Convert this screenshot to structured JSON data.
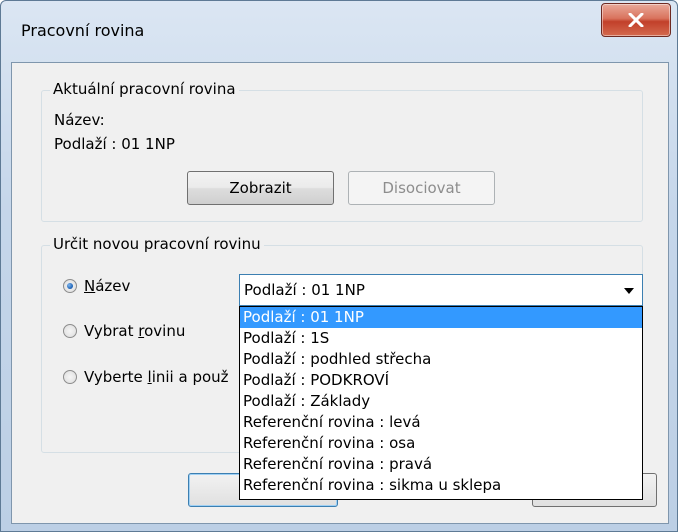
{
  "window": {
    "title": "Pracovní rovina"
  },
  "current_plane": {
    "group_label": "Aktuální pracovní rovina",
    "name_line": "Název:",
    "level_line": "Podlaží : 01 1NP",
    "show_button": "Zobrazit",
    "dissociate_button": "Disociovat"
  },
  "new_plane": {
    "group_label": "Určit novou pracovní rovinu",
    "options": [
      {
        "label": "Název",
        "mnemonic": "N",
        "checked": true
      },
      {
        "label": "Vybrat rovinu",
        "mnemonic": "r",
        "checked": false
      },
      {
        "label": "Vyberte linii a použ",
        "mnemonic": "l",
        "checked": false
      }
    ],
    "combo_value": "Podlaží : 01 1NP",
    "dropdown_items": [
      "Podlaží : 01 1NP",
      "Podlaží : 1S",
      "Podlaží : podhled střecha",
      "Podlaží : PODKROVÍ",
      "Podlaží : Základy",
      "Referenční rovina : levá",
      "Referenční rovina : osa",
      "Referenční rovina : pravá",
      "Referenční rovina : sikma u sklepa"
    ],
    "dropdown_selected_index": 0
  },
  "colors": {
    "selection": "#3399ff",
    "close_button": "#c2402a"
  },
  "icons": {
    "close": "close-icon",
    "dropdown": "chevron-down-icon"
  }
}
